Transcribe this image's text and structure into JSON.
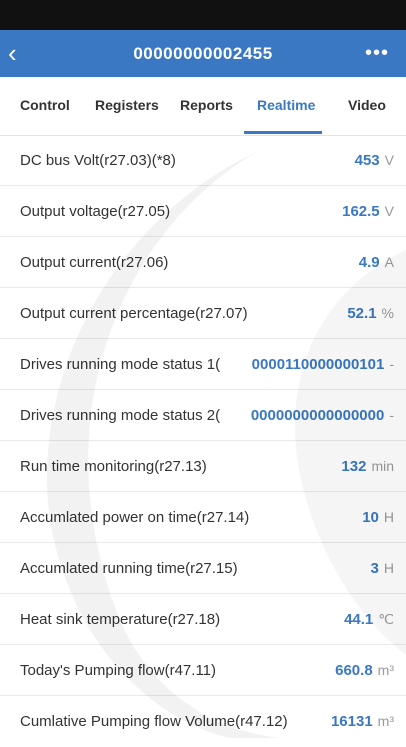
{
  "header": {
    "back_icon": "chevron-left-icon",
    "title": "00000000002455",
    "more_icon": "more-dots-icon"
  },
  "tabs": [
    {
      "label": "Control"
    },
    {
      "label": "Registers"
    },
    {
      "label": "Reports"
    },
    {
      "label": "Realtime",
      "active": true
    },
    {
      "label": "Video"
    }
  ],
  "rows": [
    {
      "label": "DC bus Volt(r27.03)(*8)",
      "value": "453",
      "unit": "V"
    },
    {
      "label": "Output voltage(r27.05)",
      "value": "162.5",
      "unit": "V"
    },
    {
      "label": "Output current(r27.06)",
      "value": "4.9",
      "unit": "A"
    },
    {
      "label": "Output current percentage(r27.07)",
      "value": "52.1",
      "unit": "%"
    },
    {
      "label": "Drives running mode status 1(",
      "value": "0000110000000101",
      "unit": "-"
    },
    {
      "label": "Drives running mode status 2(",
      "value": "0000000000000000",
      "unit": "-"
    },
    {
      "label": "Run time monitoring(r27.13)",
      "value": "132",
      "unit": "min"
    },
    {
      "label": "Accumlated power on time(r27.14)",
      "value": "10",
      "unit": "H"
    },
    {
      "label": "Accumlated running time(r27.15)",
      "value": "3",
      "unit": "H"
    },
    {
      "label": "Heat sink temperature(r27.18)",
      "value": "44.1",
      "unit": "℃"
    },
    {
      "label": "Today's Pumping flow(r47.11)",
      "value": "660.8",
      "unit": "m³"
    },
    {
      "label": "Cumlative Pumping flow Volume(r47.12)",
      "value": "16131",
      "unit": "m³"
    }
  ],
  "colors": {
    "accent": "#3a78c3",
    "status_bar": "#111111"
  }
}
